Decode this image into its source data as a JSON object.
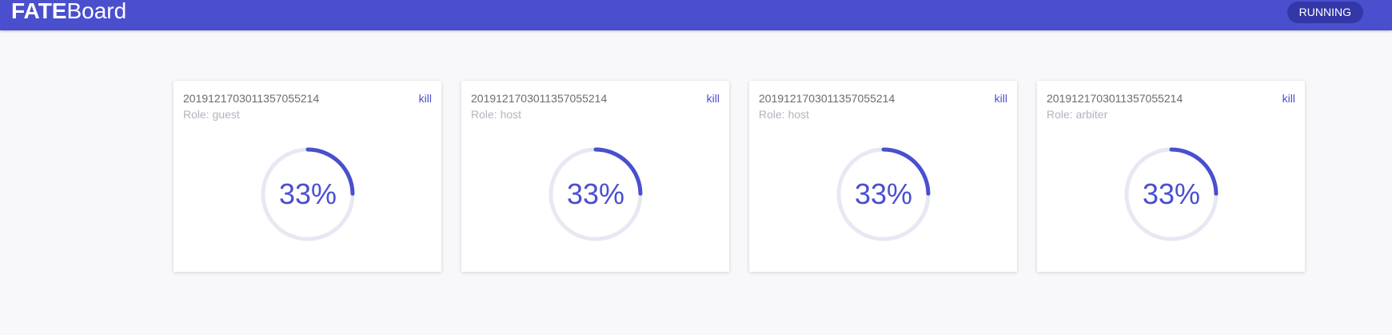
{
  "header": {
    "logo_bold": "FATE",
    "logo_light": "Board",
    "status": "RUNNING"
  },
  "colors": {
    "accent": "#4a4fce",
    "track": "#e6e9f2"
  },
  "jobs": [
    {
      "job_id": "20191217030113570552​14",
      "role": "Role: guest",
      "kill_label": "kill",
      "progress_label": "33%",
      "progress": 0.33
    },
    {
      "job_id": "2019121703011357055214",
      "role": "Role: host",
      "kill_label": "kill",
      "progress_label": "33%",
      "progress": 0.33
    },
    {
      "job_id": "2019121703011357055214",
      "role": "Role: host",
      "kill_label": "kill",
      "progress_label": "33%",
      "progress": 0.33
    },
    {
      "job_id": "2019121703011357055214",
      "role": "Role: arbiter",
      "kill_label": "kill",
      "progress_label": "33%",
      "progress": 0.33
    }
  ]
}
